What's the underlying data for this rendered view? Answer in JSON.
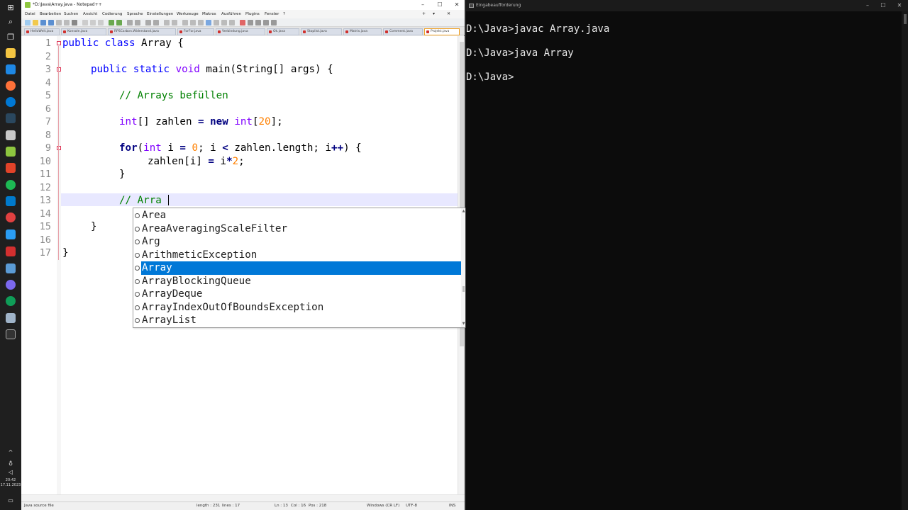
{
  "taskbar": {
    "clock_time": "20:42",
    "clock_date": "17.11.2023"
  },
  "notepad": {
    "title": "*D:\\Java\\Array.java - Notepad++",
    "menu": [
      "Datei",
      "Bearbeiten",
      "Suchen",
      "Ansicht",
      "Codierung",
      "Sprache",
      "Einstellungen",
      "Werkzeuge",
      "Makros",
      "Ausführen",
      "Plugins",
      "Fenster",
      "?"
    ],
    "tabs": [
      "HelloWelt.java",
      "Konsole.java",
      "RPSCarbon.Widerstand.java",
      "ForFor.java",
      "Verbindung.java",
      "Ok.java",
      "Stoplist.java",
      "Matrix.java",
      "Comment.java",
      "Projekt.java"
    ],
    "active_tab_index": 9,
    "line_numbers": [
      "1",
      "2",
      "3",
      "4",
      "5",
      "6",
      "7",
      "8",
      "9",
      "10",
      "11",
      "12",
      "13",
      "14",
      "15",
      "16",
      "17"
    ],
    "code": {
      "l1_kw": "public class",
      "l1_rest": " Array {",
      "l3_kw1": "public static",
      "l3_type": "void",
      "l3_rest": " main(String[] args) {",
      "l5_cmt": "// Arrays befüllen",
      "l7_type": "int",
      "l7_a": "[] zahlen ",
      "l7_eq": "=",
      "l7_new": "new",
      "l7_type2": "int",
      "l7_b": "[",
      "l7_num": "20",
      "l7_c": "];",
      "l9_for": "for",
      "l9_a": "(",
      "l9_type": "int",
      "l9_b": " i ",
      "l9_eq": "=",
      "l9_num": "0",
      "l9_c": "; i ",
      "l9_lt": "<",
      "l9_d": " zahlen.length; i",
      "l9_pp": "++",
      "l9_e": ") {",
      "l10_a": "zahlen[i] ",
      "l10_eq": "=",
      "l10_b": " i",
      "l10_mul": "*",
      "l10_num": "2",
      "l10_c": ";",
      "l11": "}",
      "l13_cmt": "// Arra",
      "l15": "}",
      "l17": "}"
    },
    "autocomplete": {
      "items": [
        "Area",
        "AreaAveragingScaleFilter",
        "Arg",
        "ArithmeticException",
        "Array",
        "ArrayBlockingQueue",
        "ArrayDeque",
        "ArrayIndexOutOfBoundsException",
        "ArrayList"
      ],
      "selected_index": 4
    },
    "status": {
      "file_type": "Java source file",
      "length": "length : 231",
      "lines": "lines : 17",
      "ln": "Ln : 13",
      "col": "Col : 16",
      "pos": "Pos : 218",
      "eol": "Windows (CR LF)",
      "encoding": "UTF-8",
      "mode": "INS"
    }
  },
  "console": {
    "title": "Eingabeaufforderung",
    "lines": [
      "D:\\Java>javac Array.java",
      "D:\\Java>java Array",
      "D:\\Java>"
    ]
  },
  "colors": {
    "keyword": "#0000ff",
    "type": "#8000ff",
    "number": "#ff8000",
    "comment": "#008000",
    "selection": "#0078d7"
  }
}
